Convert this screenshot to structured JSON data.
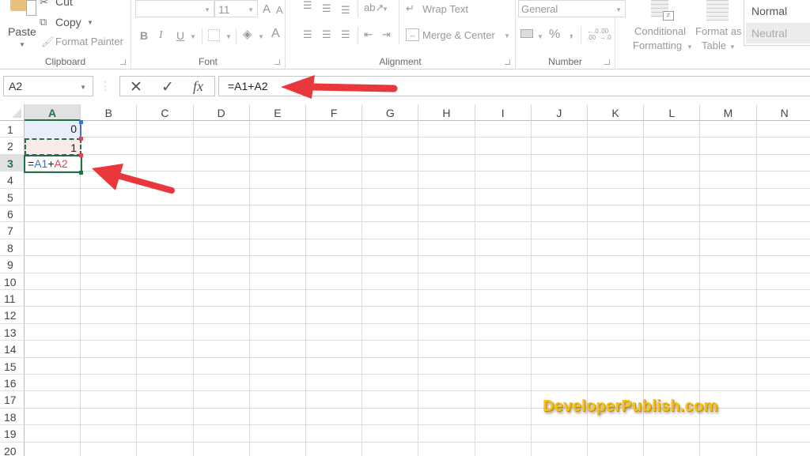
{
  "ribbon": {
    "clipboard": {
      "paste_label": "Paste",
      "cut_label": "Cut",
      "copy_label": "Copy",
      "format_painter_label": "Format Painter",
      "group_label": "Clipboard"
    },
    "font": {
      "font_name": "",
      "font_size": "11",
      "bold": "B",
      "italic": "I",
      "underline": "U",
      "grow_font": "A",
      "shrink_font": "A",
      "font_color": "A",
      "group_label": "Font"
    },
    "alignment": {
      "wrap_text_label": "Wrap Text",
      "merge_center_label": "Merge & Center",
      "group_label": "Alignment"
    },
    "number": {
      "format_value": "General",
      "percent": "%",
      "comma": ",",
      "increase_decimal": "←.0 .00",
      "decrease_decimal": ".00 →.0",
      "group_label": "Number"
    },
    "styles": {
      "conditional_formatting_line1": "Conditional",
      "conditional_formatting_line2": "Formatting",
      "format_as_table_line1": "Format as",
      "format_as_table_line2": "Table",
      "style_normal": "Normal",
      "style_neutral": "Neutral"
    }
  },
  "formula_bar": {
    "name_box": "A2",
    "cancel_icon": "✕",
    "enter_icon": "✓",
    "function_icon": "fx",
    "formula": "=A1+A2"
  },
  "sheet": {
    "columns": [
      "A",
      "B",
      "C",
      "D",
      "E",
      "F",
      "G",
      "H",
      "I",
      "J",
      "K",
      "L",
      "M",
      "N"
    ],
    "selected_column": "A",
    "rows": [
      "1",
      "2",
      "3",
      "4",
      "5",
      "6",
      "7",
      "8",
      "9",
      "10",
      "11",
      "12",
      "13",
      "14",
      "15",
      "16",
      "17",
      "18",
      "19",
      "20"
    ],
    "selected_row": "3",
    "cells": {
      "A1": "0",
      "A2": "1",
      "A3_formula": {
        "eq": "=",
        "ref1": "A1",
        "op": "+",
        "ref2": "A2"
      }
    },
    "colors": {
      "accent_green": "#217346",
      "ref_blue": "#4472c4",
      "ref_red": "#e0474c",
      "arrow_red": "#e8383d"
    }
  },
  "watermark": "DeveloperPublish.com"
}
